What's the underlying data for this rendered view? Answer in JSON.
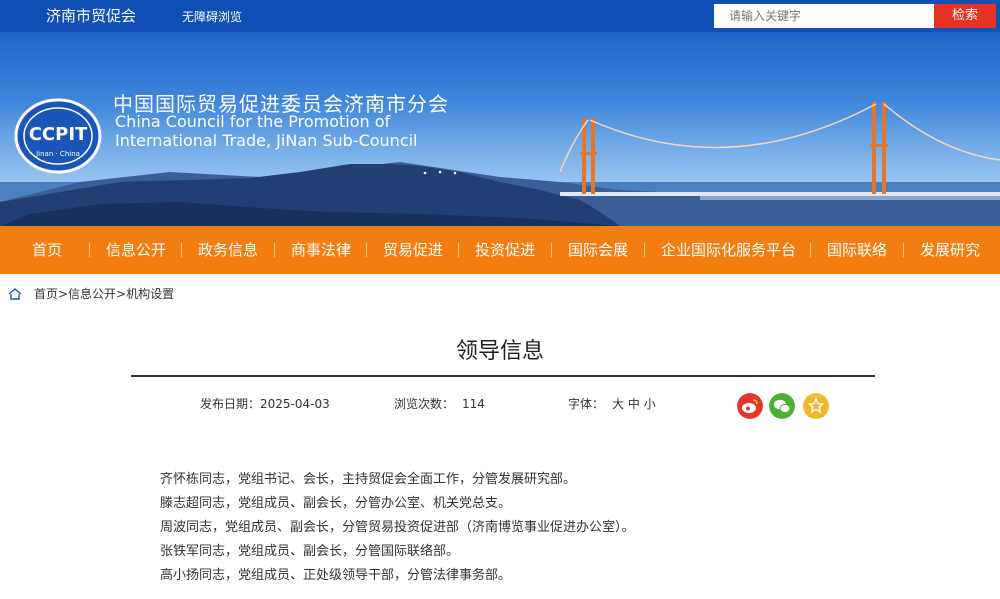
{
  "topbar": {
    "site_name": "济南市贸促会",
    "accessibility_link": "无障碍浏览",
    "search_placeholder": "请输入关键字",
    "search_button": "检索"
  },
  "banner": {
    "logo_text": "CCPIT",
    "logo_subtext": "Jinan · China",
    "org_name_cn": "中国国际贸易促进委员会济南市分会",
    "org_name_en_line1": "China Council for the Promotion of",
    "org_name_en_line2": "International Trade, JiNan Sub-Council"
  },
  "nav": {
    "items": [
      "首页",
      "信息公开",
      "政务信息",
      "商事法律",
      "贸易促进",
      "投资促进",
      "国际会展",
      "企业国际化服务平台",
      "国际联络",
      "发展研究"
    ]
  },
  "breadcrumb": {
    "text": "首页>信息公开>机构设置"
  },
  "article": {
    "title": "领导信息",
    "publish_label": "发布日期：",
    "publish_date": "2025-04-03",
    "views_label": "浏览次数：",
    "views": "114",
    "font_label": "字体：",
    "font_large": "大",
    "font_medium": "中",
    "font_small": "小",
    "paragraphs": [
      "齐怀栋同志，党组书记、会长，主持贸促会全面工作，分管发展研究部。",
      "滕志超同志，党组成员、副会长，分管办公室、机关党总支。",
      "周波同志，党组成员、副会长，分管贸易投资促进部（济南博览事业促进办公室）。",
      "张铁军同志，党组成员、副会长，分管国际联络部。",
      "高小扬同志，党组成员、正处级领导干部，分管法律事务部。"
    ]
  },
  "share": {
    "icons": [
      "weibo-icon",
      "wechat-icon",
      "favorite-icon"
    ],
    "colors": [
      "#e6352b",
      "#4ab233",
      "#f0b82a"
    ]
  },
  "colors": {
    "topbar": "#0f4fb6",
    "nav": "#f27e11",
    "search_button": "#e63123"
  }
}
